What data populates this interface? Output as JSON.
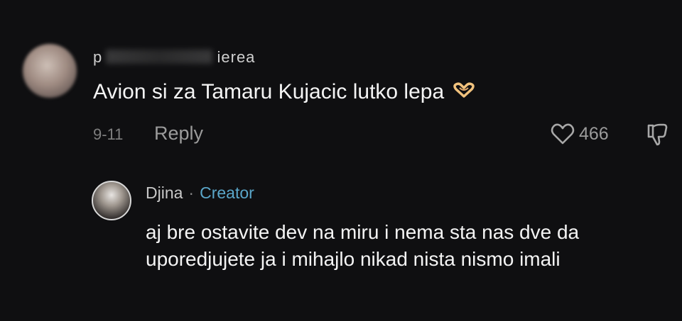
{
  "comment": {
    "username_visible_start": "p",
    "username_visible_end": "ierea",
    "text": "Avion si za Tamaru Kujacic lutko lepa",
    "emoji_icon": "heart-hands-icon",
    "date": "9-11",
    "reply_label": "Reply",
    "like_count": "466"
  },
  "reply": {
    "username": "Djina",
    "separator": "·",
    "badge": "Creator",
    "text": "aj bre ostavite dev na miru i nema sta nas dve da uporedjujete ja i mihajlo nikad nista nismo imali"
  },
  "colors": {
    "background": "#0f0f11",
    "creator_badge": "#5aa6c9",
    "muted": "#9b9b9b"
  }
}
